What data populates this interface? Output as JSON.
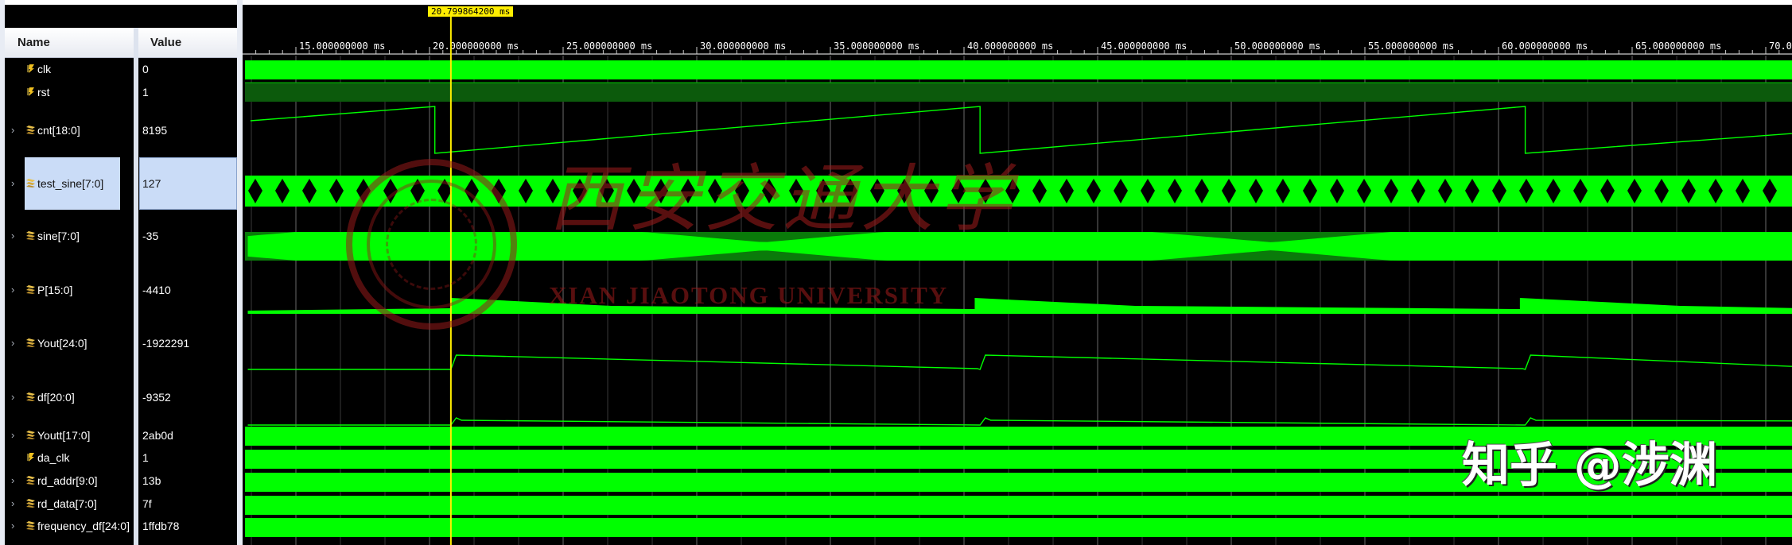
{
  "header": {
    "name_label": "Name",
    "value_label": "Value"
  },
  "signals": [
    {
      "name": "clk",
      "value": "0",
      "icon": "bit-signal-icon",
      "expandable": false
    },
    {
      "name": "rst",
      "value": "1",
      "icon": "bit-signal-icon",
      "expandable": false
    },
    {
      "name": "cnt[18:0]",
      "value": "8195",
      "icon": "bus-signal-icon",
      "expandable": true
    },
    {
      "name": "test_sine[7:0]",
      "value": "127",
      "icon": "bus-signal-icon",
      "expandable": true,
      "selected": true
    },
    {
      "name": "sine[7:0]",
      "value": "-35",
      "icon": "bus-signal-icon",
      "expandable": true
    },
    {
      "name": "P[15:0]",
      "value": "-4410",
      "icon": "bus-signal-icon",
      "expandable": true
    },
    {
      "name": "Yout[24:0]",
      "value": "-1922291",
      "icon": "bus-signal-icon",
      "expandable": true
    },
    {
      "name": "df[20:0]",
      "value": "-9352",
      "icon": "bus-signal-icon",
      "expandable": true
    },
    {
      "name": "Youtt[17:0]",
      "value": "2ab0d",
      "icon": "bus-signal-icon",
      "expandable": true
    },
    {
      "name": "da_clk",
      "value": "1",
      "icon": "bit-signal-icon",
      "expandable": false
    },
    {
      "name": "rd_addr[9:0]",
      "value": "13b",
      "icon": "bus-signal-icon",
      "expandable": true
    },
    {
      "name": "rd_data[7:0]",
      "value": "7f",
      "icon": "bus-signal-icon",
      "expandable": true
    },
    {
      "name": "frequency_df[24:0]",
      "value": "1ffdb78",
      "icon": "bus-signal-icon",
      "expandable": true
    }
  ],
  "timeline": {
    "tick_labels": [
      "15.000000000 ms",
      "20.000000000 ms",
      "25.000000000 ms",
      "30.000000000 ms",
      "35.000000000 ms",
      "40.000000000 ms",
      "45.000000000 ms",
      "50.000000000 ms",
      "55.000000000 ms",
      "60.000000000 ms",
      "65.000000000 ms",
      "70.000000000 ms"
    ],
    "tick_values_ms": [
      15,
      20,
      25,
      30,
      35,
      40,
      45,
      50,
      55,
      60,
      65,
      70
    ],
    "cursor_label": "20.799864200 ms",
    "cursor_ms": 20.7998642
  },
  "watermarks": {
    "university_cn": "西安交通大学",
    "university_en": "XIAN JIAOTONG UNIVERSITY",
    "zhihu": "知乎 @涉渊"
  },
  "colors": {
    "waveform": "#00ff00",
    "cursor": "#ffee00",
    "background": "#000000",
    "selection": "#cadcf7"
  }
}
